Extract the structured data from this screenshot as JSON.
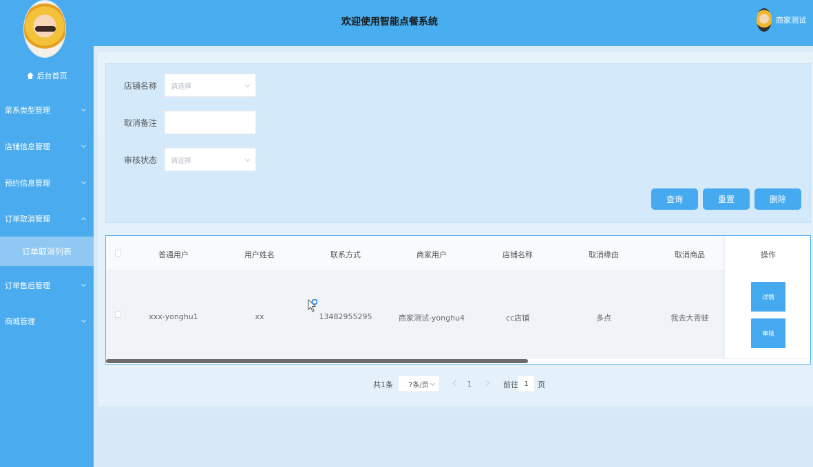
{
  "header": {
    "title": "欢迎使用智能点餐系统",
    "user_name": "商家测试",
    "avatar_icon": "user-avatar-icon"
  },
  "sidebar": {
    "avatar_icon": "profile-avatar-icon",
    "home_label": "后台首页",
    "items": [
      {
        "label": "菜系类型管理"
      },
      {
        "label": "店铺信息管理"
      },
      {
        "label": "预约信息管理"
      },
      {
        "label": "订单取消管理"
      },
      {
        "label": "订单售后管理"
      },
      {
        "label": "商城管理"
      }
    ],
    "active_submenu": "订单取消列表"
  },
  "form": {
    "shop_name_label": "店铺名称",
    "shop_name_placeholder": "请选择",
    "cancel_note_label": "取消备注",
    "cancel_note_value": "",
    "audit_status_label": "审核状态",
    "audit_status_placeholder": "请选择",
    "buttons": {
      "query": "查询",
      "reset": "重置",
      "delete": "删除"
    }
  },
  "table": {
    "headers": [
      "普通用户",
      "用户姓名",
      "联系方式",
      "商家用户",
      "店铺名称",
      "取消缘由",
      "取消商品",
      "操作"
    ],
    "rows": [
      {
        "regular_user": "xxx-yonghu1",
        "user_name": "xx",
        "contact": "13482955295",
        "merchant_user": "商家测试-yonghu4",
        "shop_name": "cc店铺",
        "cancel_reason": "多点",
        "cancel_item": "我去大青蛙",
        "actions": {
          "detail": "详情",
          "audit": "审核"
        }
      }
    ]
  },
  "pagination": {
    "total_text": "共1条",
    "page_size": "7条/页",
    "current_page": "1",
    "goto_prefix": "前往",
    "goto_value": "1",
    "goto_suffix": "页"
  },
  "colors": {
    "primary": "#46aaf0",
    "sidebar": "#4aacee",
    "header": "#48aef0"
  }
}
